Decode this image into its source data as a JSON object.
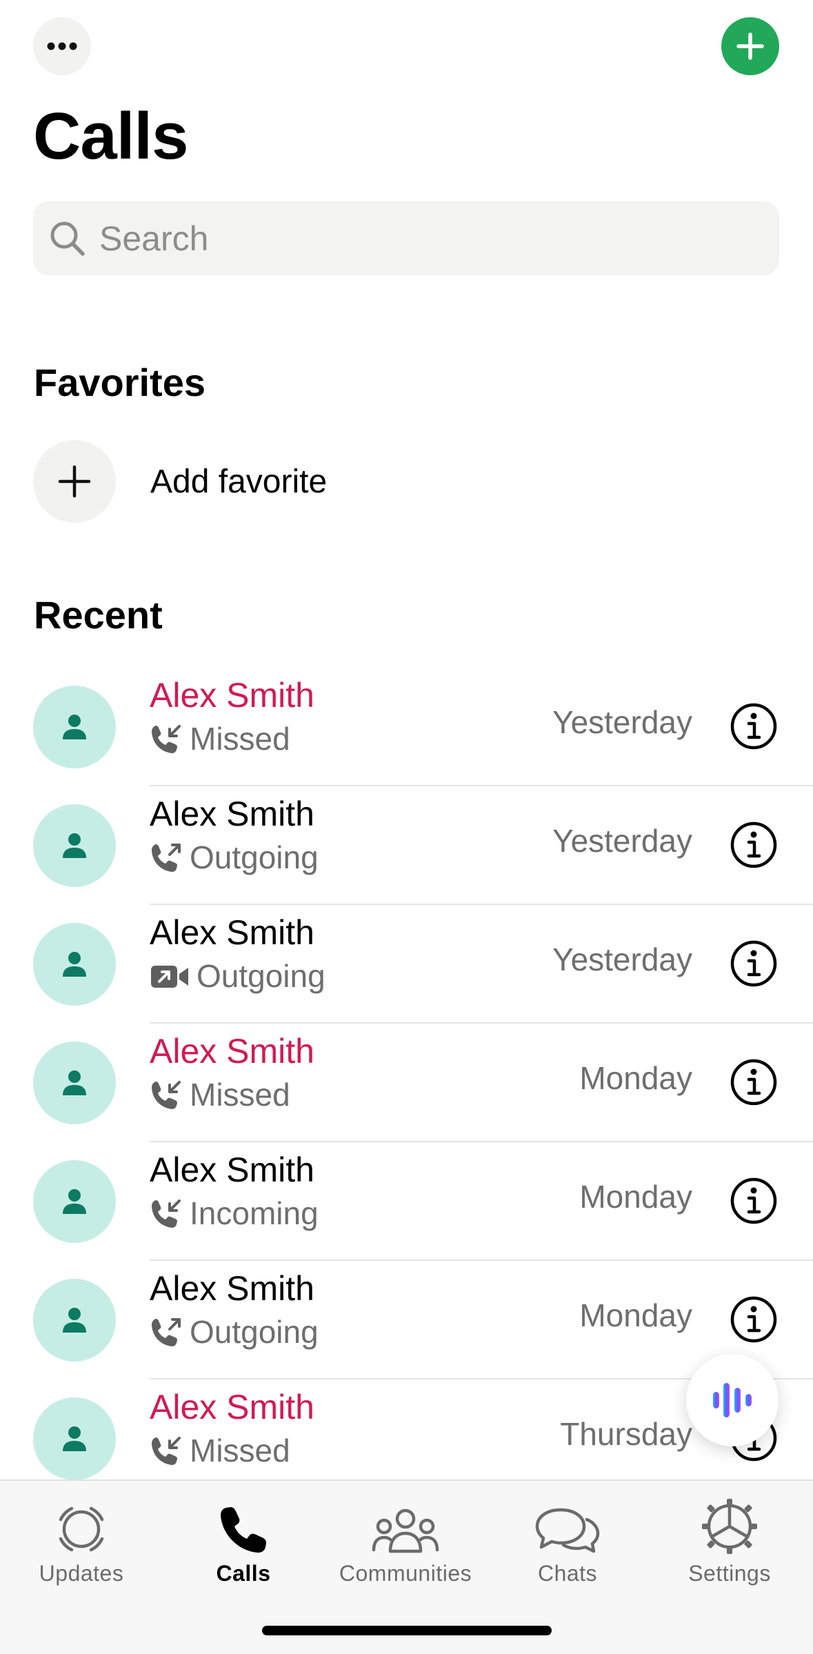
{
  "header": {
    "title": "Calls",
    "more_icon": "ellipsis-icon",
    "new_call_icon": "plus-icon",
    "accent_color": "#21a858"
  },
  "search": {
    "placeholder": "Search",
    "value": ""
  },
  "favorites": {
    "title": "Favorites",
    "add_label": "Add favorite"
  },
  "recent": {
    "title": "Recent",
    "missed_color": "#d11a52",
    "calls": [
      {
        "name": "Alex Smith",
        "type": "Missed",
        "kind": "voice-incoming",
        "time": "Yesterday",
        "missed": true
      },
      {
        "name": "Alex Smith",
        "type": "Outgoing",
        "kind": "voice-outgoing",
        "time": "Yesterday",
        "missed": false
      },
      {
        "name": "Alex Smith",
        "type": "Outgoing",
        "kind": "video-outgoing",
        "time": "Yesterday",
        "missed": false
      },
      {
        "name": "Alex Smith",
        "type": "Missed",
        "kind": "voice-incoming",
        "time": "Monday",
        "missed": true
      },
      {
        "name": "Alex Smith",
        "type": "Incoming",
        "kind": "voice-incoming",
        "time": "Monday",
        "missed": false
      },
      {
        "name": "Alex Smith",
        "type": "Outgoing",
        "kind": "voice-outgoing",
        "time": "Monday",
        "missed": false
      },
      {
        "name": "Alex Smith",
        "type": "Missed",
        "kind": "voice-incoming",
        "time": "Thursday",
        "missed": true
      }
    ]
  },
  "tabs": [
    {
      "label": "Updates",
      "icon": "updates-icon",
      "active": false
    },
    {
      "label": "Calls",
      "icon": "phone-icon",
      "active": true
    },
    {
      "label": "Communities",
      "icon": "communities-icon",
      "active": false
    },
    {
      "label": "Chats",
      "icon": "chats-icon",
      "active": false
    },
    {
      "label": "Settings",
      "icon": "settings-icon",
      "active": false
    }
  ]
}
